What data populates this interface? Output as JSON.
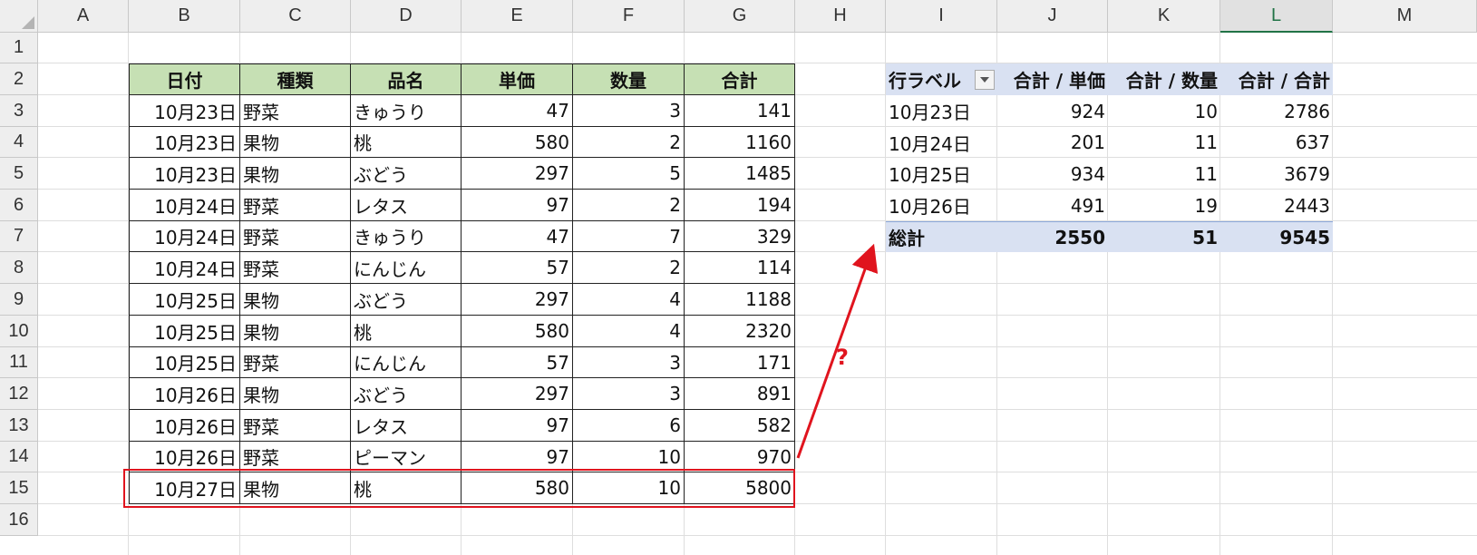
{
  "columns": [
    "A",
    "B",
    "C",
    "D",
    "E",
    "F",
    "G",
    "H",
    "I",
    "J",
    "K",
    "L",
    "M"
  ],
  "selected_column": "L",
  "rows": [
    "1",
    "2",
    "3",
    "4",
    "5",
    "6",
    "7",
    "8",
    "9",
    "10",
    "11",
    "12",
    "13",
    "14",
    "15",
    "16"
  ],
  "source_table": {
    "headers": [
      "日付",
      "種類",
      "品名",
      "単価",
      "数量",
      "合計"
    ],
    "rows": [
      [
        "10月23日",
        "野菜",
        "きゅうり",
        "47",
        "3",
        "141"
      ],
      [
        "10月23日",
        "果物",
        "桃",
        "580",
        "2",
        "1160"
      ],
      [
        "10月23日",
        "果物",
        "ぶどう",
        "297",
        "5",
        "1485"
      ],
      [
        "10月24日",
        "野菜",
        "レタス",
        "97",
        "2",
        "194"
      ],
      [
        "10月24日",
        "野菜",
        "きゅうり",
        "47",
        "7",
        "329"
      ],
      [
        "10月24日",
        "野菜",
        "にんじん",
        "57",
        "2",
        "114"
      ],
      [
        "10月25日",
        "果物",
        "ぶどう",
        "297",
        "4",
        "1188"
      ],
      [
        "10月25日",
        "果物",
        "桃",
        "580",
        "4",
        "2320"
      ],
      [
        "10月25日",
        "野菜",
        "にんじん",
        "57",
        "3",
        "171"
      ],
      [
        "10月26日",
        "果物",
        "ぶどう",
        "297",
        "3",
        "891"
      ],
      [
        "10月26日",
        "野菜",
        "レタス",
        "97",
        "6",
        "582"
      ],
      [
        "10月26日",
        "野菜",
        "ピーマン",
        "97",
        "10",
        "970"
      ],
      [
        "10月27日",
        "果物",
        "桃",
        "580",
        "10",
        "5800"
      ]
    ]
  },
  "pivot": {
    "headers": [
      "行ラベル",
      "合計 / 単価",
      "合計 / 数量",
      "合計 / 合計"
    ],
    "rows": [
      [
        "10月23日",
        "924",
        "10",
        "2786"
      ],
      [
        "10月24日",
        "201",
        "11",
        "637"
      ],
      [
        "10月25日",
        "934",
        "11",
        "3679"
      ],
      [
        "10月26日",
        "491",
        "19",
        "2443"
      ]
    ],
    "total": [
      "総計",
      "2550",
      "51",
      "9545"
    ]
  },
  "annotation": {
    "mark": "?",
    "color": "#e0141e"
  },
  "colors": {
    "header_green": "#c6e0b4",
    "pivot_blue": "#d9e1f2",
    "excel_green": "#217346"
  }
}
